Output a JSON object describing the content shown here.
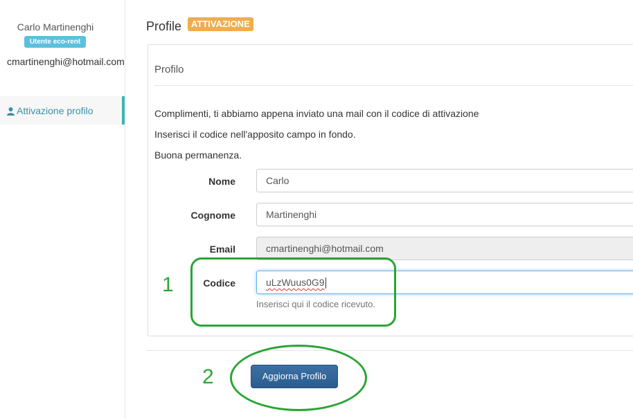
{
  "sidebar": {
    "user_name": "Carlo Martinenghi",
    "user_badge": "Utente eco-rent",
    "user_email": "cmartinenghi@hotmail.com",
    "nav": [
      {
        "label": "Attivazione profilo",
        "icon": "user-icon",
        "active": true
      }
    ]
  },
  "header": {
    "title": "Profile",
    "status_label": "ATTIVAZIONE"
  },
  "panel": {
    "title": "Profilo",
    "messages": [
      "Complimenti, ti abbiamo appena inviato una mail con il codice di attivazione",
      "Inserisci il codice nell'apposito campo in fondo.",
      "Buona permanenza."
    ],
    "form": {
      "nome": {
        "label": "Nome",
        "value": "Carlo"
      },
      "cognome": {
        "label": "Cognome",
        "value": "Martinenghi"
      },
      "email": {
        "label": "Email",
        "value": "cmartinenghi@hotmail.com"
      },
      "codice": {
        "label": "Codice",
        "value": "uLzWuus0G9",
        "help": "Inserisci qui il codice ricevuto."
      }
    }
  },
  "actions": {
    "submit_label": "Aggiorna Profilo"
  },
  "annotations": {
    "step1": "1",
    "step2": "2"
  },
  "colors": {
    "accent": "#3cb4b4",
    "badge": "#5bc0de",
    "status": "#f0ad4e",
    "primary_button": "#2f6295",
    "annotation": "#2aa534"
  }
}
